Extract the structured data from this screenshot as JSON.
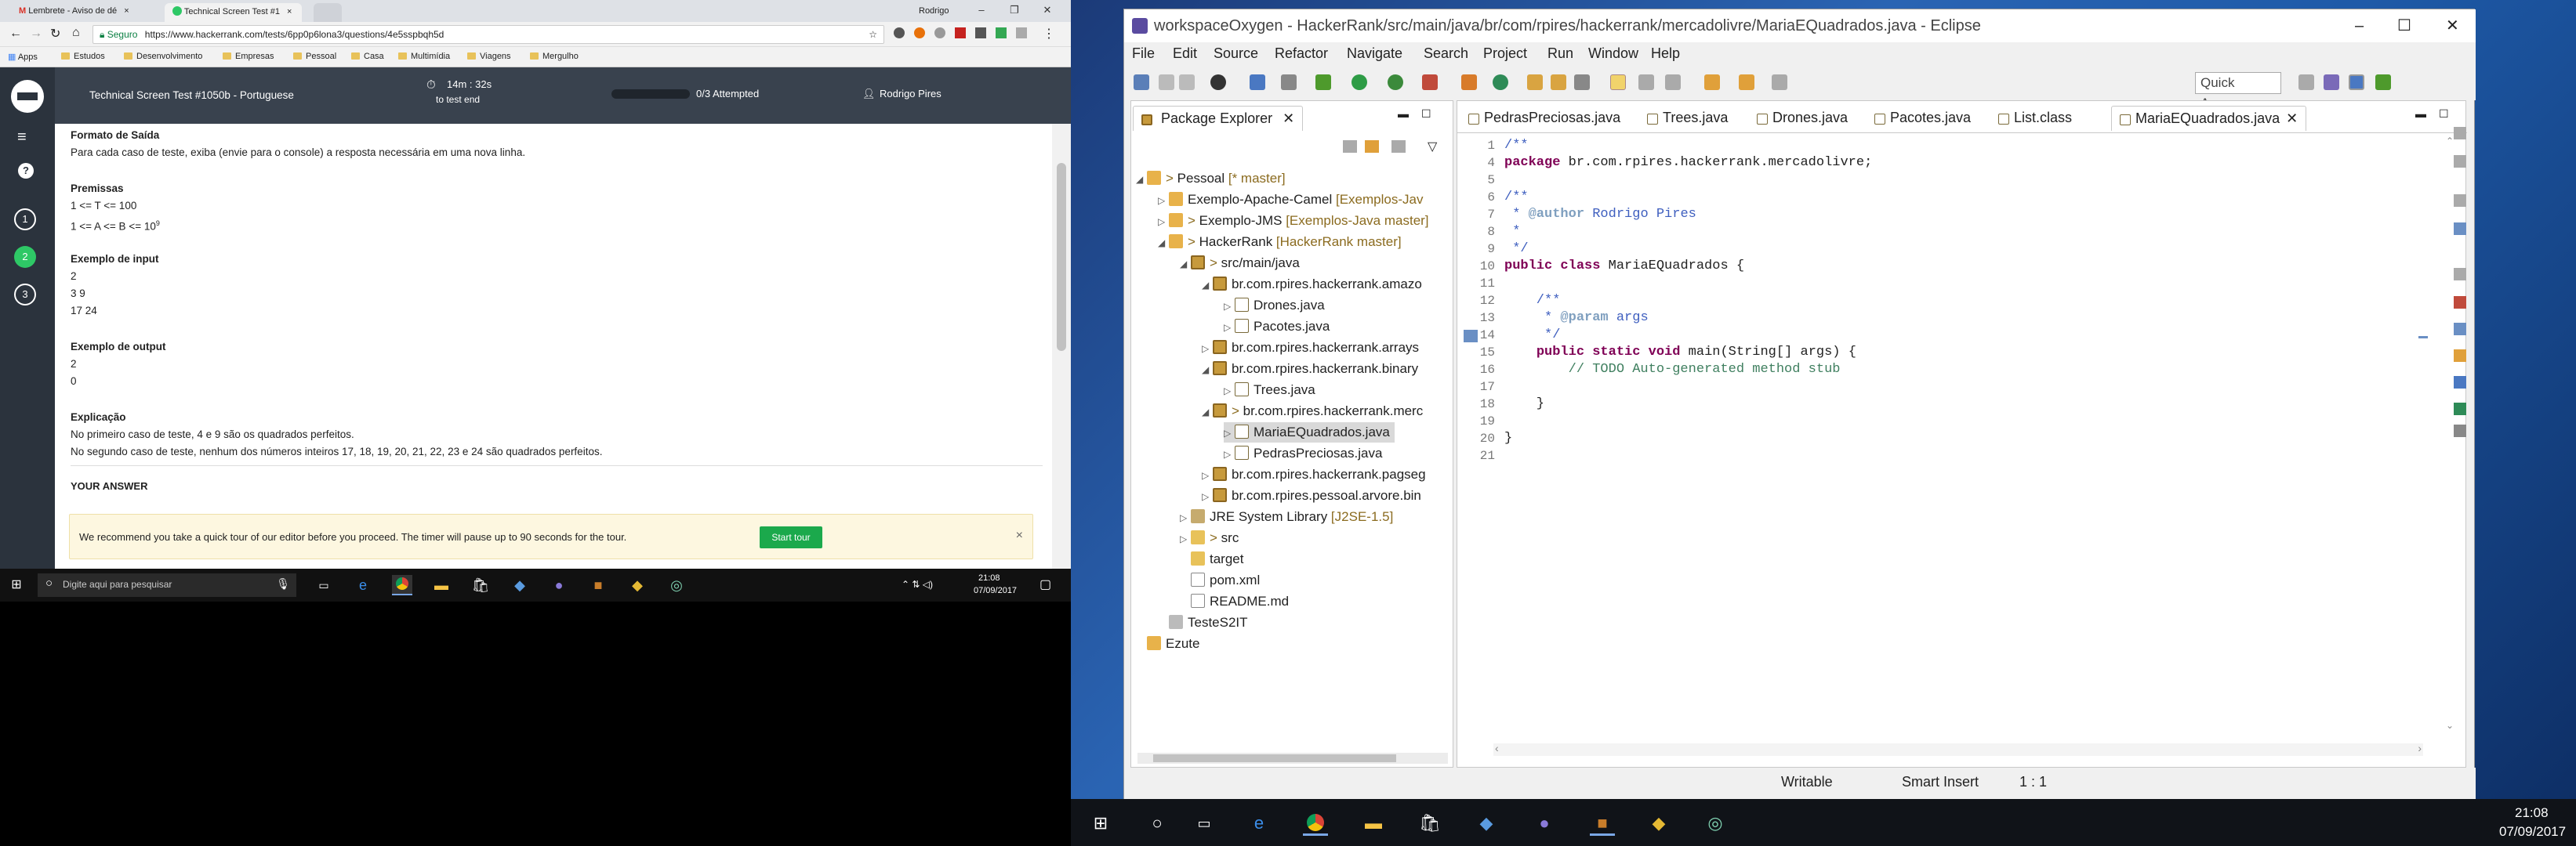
{
  "browser": {
    "tabs": [
      {
        "label": "Lembrete - Aviso de dé"
      },
      {
        "label": "Technical Screen Test #1"
      }
    ],
    "user_name": "Rodrigo",
    "secure_label": "Seguro",
    "url": "https://www.hackerrank.com/tests/6pp0p6lona3/questions/4e5sspbqh5d",
    "bookmarks": [
      "Apps",
      "Estudos",
      "Desenvolvimento",
      "Empresas",
      "Pessoal",
      "Casa",
      "Multimídia",
      "Viagens",
      "Mergulho"
    ]
  },
  "hackerrank": {
    "test_title": "Technical Screen Test #1050b - Portuguese",
    "timer": "14m : 32s",
    "timer_sub": "to test end",
    "attempted": "0/3 Attempted",
    "user": "Rodrigo Pires",
    "question_numbers": [
      "1",
      "2",
      "3"
    ],
    "output_format_heading": "Formato de Saída",
    "output_format_text": "Para cada caso de teste, exiba (envie para o console) a resposta necessária em uma nova linha.",
    "premises_heading": "Premissas",
    "premise_1": "1 <= T <= 100",
    "premise_2": "1 <= A <= B <= 10",
    "premise_2_exp": "9",
    "input_heading": "Exemplo de input",
    "input_lines": [
      "2",
      "3 9",
      "17 24"
    ],
    "output_heading": "Exemplo de output",
    "output_lines": [
      "2",
      "0"
    ],
    "explanation_heading": "Explicação",
    "explanation_1": "No primeiro caso de teste, 4 e 9 são os quadrados perfeitos.",
    "explanation_2": "No segundo caso de teste, nenhum dos números inteiros 17, 18, 19, 20, 21, 22, 23 e 24 são quadrados perfeitos.",
    "your_answer": "YOUR ANSWER",
    "tour_text": "We recommend you take a quick tour of our editor before you proceed. The timer will pause up to 90 seconds for the tour.",
    "start_tour": "Start tour"
  },
  "taskbar_left": {
    "search_placeholder": "Digite aqui para pesquisar",
    "time": "21:08",
    "date": "07/09/2017"
  },
  "eclipse": {
    "title": "workspaceOxygen - HackerRank/src/main/java/br/com/rpires/hackerrank/mercadolivre/MariaEQuadrados.java - Eclipse",
    "menu": [
      "File",
      "Edit",
      "Source",
      "Refactor",
      "Navigate",
      "Search",
      "Project",
      "Run",
      "Window",
      "Help"
    ],
    "quick_access": "Quick Access",
    "package_explorer": "Package Explorer",
    "editor_tabs": [
      "PedrasPreciosas.java",
      "Trees.java",
      "Drones.java",
      "Pacotes.java",
      "List.class",
      "MariaEQuadrados.java"
    ],
    "tree": [
      {
        "label": "Pessoal",
        "suffix": " [* master]",
        "prefix": "> "
      },
      {
        "label": "Exemplo-Apache-Camel",
        "suffix": " [Exemplos-Jav"
      },
      {
        "label": "Exemplo-JMS",
        "suffix": " [Exemplos-Java master]",
        "prefix": "> "
      },
      {
        "label": "HackerRank",
        "suffix": " [HackerRank master]",
        "prefix": "> "
      },
      {
        "label": "src/main/java",
        "prefix": "> "
      },
      {
        "label": "br.com.rpires.hackerrank.amazo"
      },
      {
        "label": "Drones.java"
      },
      {
        "label": "Pacotes.java"
      },
      {
        "label": "br.com.rpires.hackerrank.arrays"
      },
      {
        "label": "br.com.rpires.hackerrank.binary"
      },
      {
        "label": "Trees.java"
      },
      {
        "label": "br.com.rpires.hackerrank.merc",
        "prefix": "> "
      },
      {
        "label": "MariaEQuadrados.java"
      },
      {
        "label": "PedrasPreciosas.java"
      },
      {
        "label": "br.com.rpires.hackerrank.pagseg"
      },
      {
        "label": "br.com.rpires.pessoal.arvore.bin"
      },
      {
        "label": "JRE System Library",
        "suffix": " [J2SE-1.5]"
      },
      {
        "label": "src",
        "prefix": "> "
      },
      {
        "label": "target"
      },
      {
        "label": "pom.xml"
      },
      {
        "label": "README.md"
      },
      {
        "label": "TesteS2IT"
      },
      {
        "label": "Ezute"
      }
    ],
    "code_lines": [
      {
        "n": "1",
        "t": "/**"
      },
      {
        "n": "4",
        "t": "package br.com.rpires.hackerrank.mercadolivre;"
      },
      {
        "n": "5",
        "t": ""
      },
      {
        "n": "6",
        "t": "/**"
      },
      {
        "n": "7",
        "t": " * @author Rodrigo Pires"
      },
      {
        "n": "8",
        "t": " *"
      },
      {
        "n": "9",
        "t": " */"
      },
      {
        "n": "10",
        "t": "public class MariaEQuadrados {"
      },
      {
        "n": "11",
        "t": ""
      },
      {
        "n": "12",
        "t": "    /**"
      },
      {
        "n": "13",
        "t": "     * @param args"
      },
      {
        "n": "14",
        "t": "     */"
      },
      {
        "n": "15",
        "t": "    public static void main(String[] args) {"
      },
      {
        "n": "16",
        "t": "        // TODO Auto-generated method stub"
      },
      {
        "n": "17",
        "t": ""
      },
      {
        "n": "18",
        "t": "    }"
      },
      {
        "n": "19",
        "t": ""
      },
      {
        "n": "20",
        "t": "}"
      },
      {
        "n": "21",
        "t": ""
      }
    ],
    "status_writable": "Writable",
    "status_insert": "Smart Insert",
    "status_pos": "1 : 1"
  },
  "taskbar_right": {
    "time": "21:08",
    "date": "07/09/2017"
  }
}
